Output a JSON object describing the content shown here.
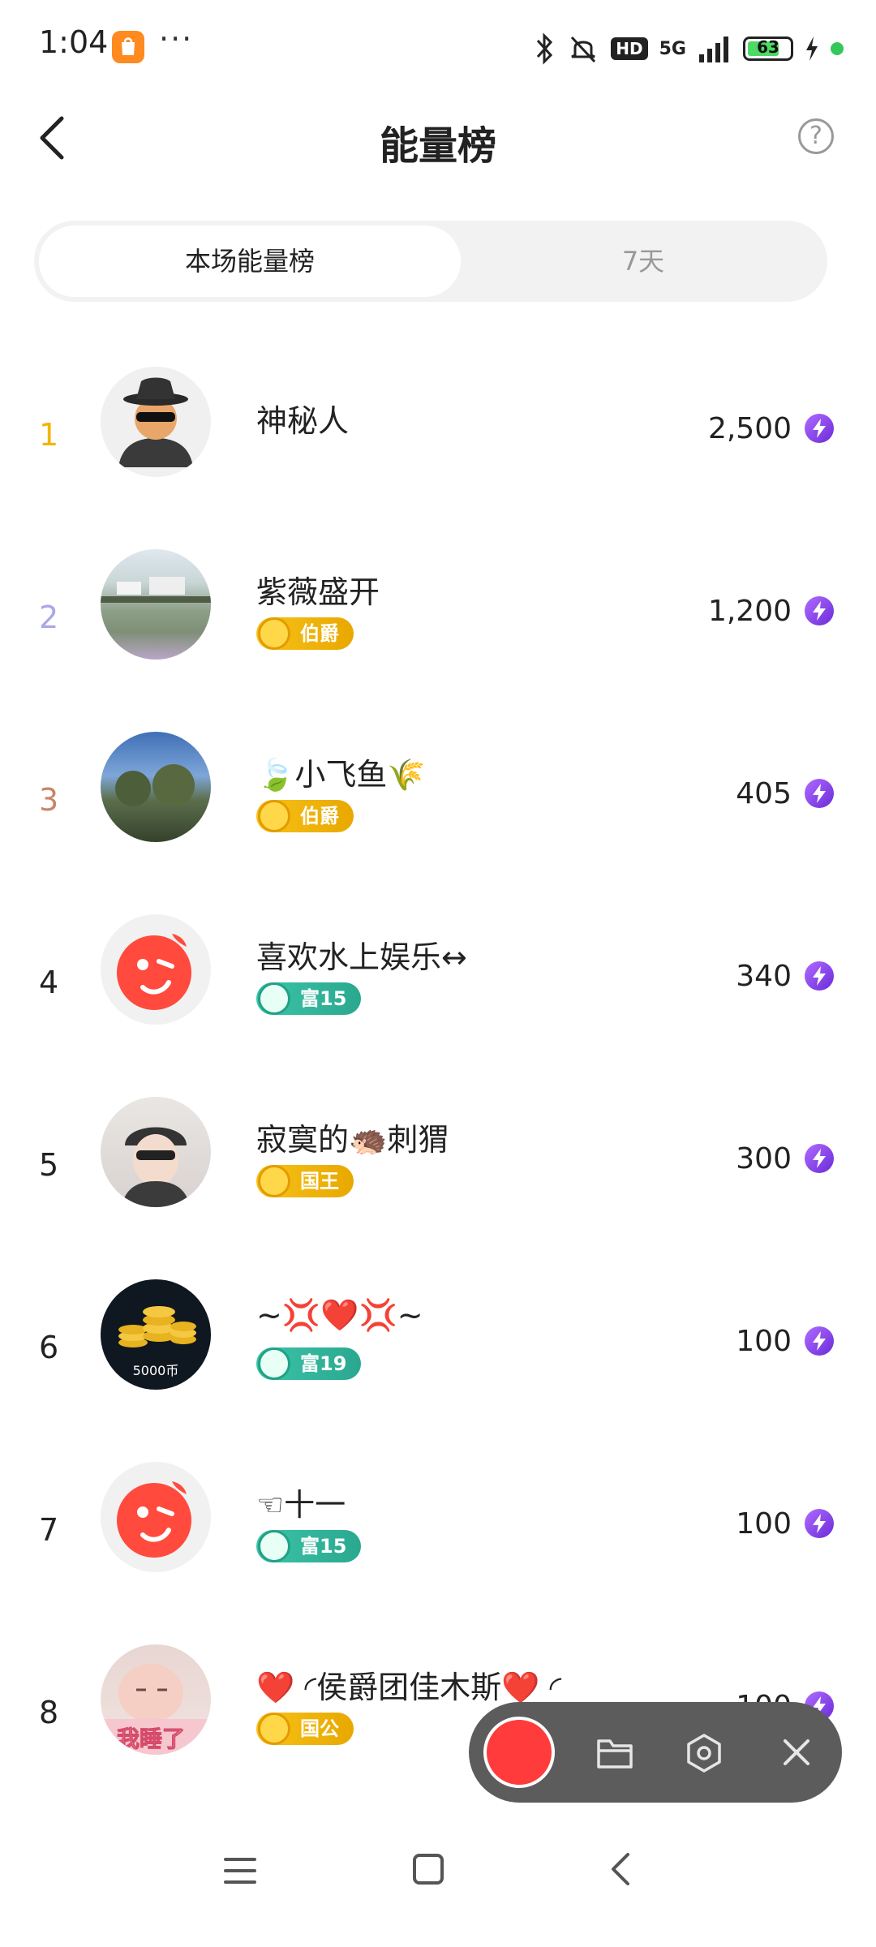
{
  "status_bar": {
    "time": "1:04",
    "more": "···",
    "signal_label": "5G",
    "hd_label": "HD",
    "battery_level": "63"
  },
  "header": {
    "title": "能量榜",
    "help": "?"
  },
  "tabs": [
    {
      "label": "本场能量榜",
      "active": true
    },
    {
      "label": "7天",
      "active": false
    }
  ],
  "rankings": [
    {
      "rank": "1",
      "name": "神秘人",
      "badge": null,
      "score": "2,500"
    },
    {
      "rank": "2",
      "name": "紫薇盛开",
      "badge": "伯爵",
      "badge_style": "gold",
      "score": "1,200"
    },
    {
      "rank": "3",
      "name": "🍃小飞鱼🌾",
      "badge": "伯爵",
      "badge_style": "gold",
      "score": "405"
    },
    {
      "rank": "4",
      "name": "喜欢水上娱乐↔",
      "badge": "富15",
      "badge_style": "teal",
      "score": "340"
    },
    {
      "rank": "5",
      "name": "寂寞的🦔刺猬",
      "badge": "国王",
      "badge_style": "gold",
      "score": "300"
    },
    {
      "rank": "6",
      "name": "~💢❤️💢~",
      "badge": "富19",
      "badge_style": "teal",
      "score": "100"
    },
    {
      "rank": "7",
      "name": "☜十一",
      "badge": "富15",
      "badge_style": "teal",
      "score": "100"
    },
    {
      "rank": "8",
      "name": "❤️ ◜侯爵团佳木斯❤️ ◜",
      "badge": "国公",
      "badge_style": "gold",
      "score": "100"
    }
  ],
  "avatars": {
    "coin_caption": "5000币",
    "sleep_caption": "我睡了"
  },
  "colors": {
    "rank1": "#f2b500",
    "rank2": "#a8a8e8",
    "rank3": "#c8856a",
    "energy": "#8a3cf0",
    "recorder_bg": "#5c5c5c",
    "record_red": "#ff3b3b"
  },
  "icons": {
    "back": "back-chevron-icon",
    "help": "question-circle-icon",
    "energy": "lightning-icon",
    "recorder_folder": "folder-icon",
    "recorder_settings": "hexagon-settings-icon",
    "recorder_close": "close-icon",
    "nav_menu": "menu-icon",
    "nav_home": "square-home-icon",
    "nav_back": "back-triangle-icon"
  }
}
